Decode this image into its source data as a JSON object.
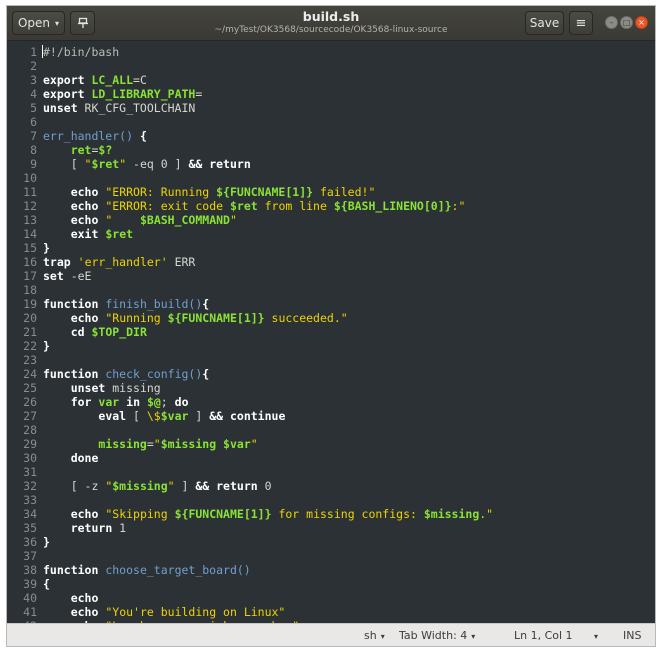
{
  "window": {
    "title": "build.sh",
    "subtitle": "~/myTest/OK3568/sourcecode/OK3568-linux-source"
  },
  "header": {
    "open_label": "Open",
    "open_caret": "▾",
    "pin_icon": "pin-icon",
    "save_label": "Save",
    "menu_glyph": "≡",
    "min_glyph": "–",
    "max_glyph": "□",
    "close_glyph": "×"
  },
  "colors": {
    "editor_bg": "#2b3135",
    "keyword": "#ffffff",
    "variable": "#8ae234",
    "string": "#edd400",
    "function_name": "#729fcf",
    "line_number": "#878c8f",
    "close_button": "#e8582a"
  },
  "editor": {
    "language": "sh",
    "lines": [
      [
        [
          "cm",
          "#!/bin/bash"
        ]
      ],
      [],
      [
        [
          "kw",
          "export"
        ],
        [
          "tx",
          " "
        ],
        [
          "var",
          "LC_ALL"
        ],
        [
          "tx",
          "=C"
        ]
      ],
      [
        [
          "kw",
          "export"
        ],
        [
          "tx",
          " "
        ],
        [
          "var",
          "LD_LIBRARY_PATH"
        ],
        [
          "tx",
          "="
        ]
      ],
      [
        [
          "kw",
          "unset"
        ],
        [
          "tx",
          " RK_CFG_TOOLCHAIN"
        ]
      ],
      [],
      [
        [
          "fn",
          "err_handler()"
        ],
        [
          "tx",
          " "
        ],
        [
          "kw",
          "{"
        ]
      ],
      [
        [
          "tx",
          "    "
        ],
        [
          "var",
          "ret"
        ],
        [
          "tx",
          "="
        ],
        [
          "var",
          "$?"
        ]
      ],
      [
        [
          "tx",
          "    [ "
        ],
        [
          "str",
          "\""
        ],
        [
          "var",
          "$ret"
        ],
        [
          "str",
          "\""
        ],
        [
          "tx",
          " -eq 0 ] "
        ],
        [
          "kw",
          "&& return"
        ]
      ],
      [],
      [
        [
          "tx",
          "    "
        ],
        [
          "kw",
          "echo"
        ],
        [
          "tx",
          " "
        ],
        [
          "str",
          "\"ERROR: Running "
        ],
        [
          "var",
          "${FUNCNAME[1]}"
        ],
        [
          "str",
          " failed!\""
        ]
      ],
      [
        [
          "tx",
          "    "
        ],
        [
          "kw",
          "echo"
        ],
        [
          "tx",
          " "
        ],
        [
          "str",
          "\"ERROR: exit code "
        ],
        [
          "var",
          "$ret"
        ],
        [
          "str",
          " from line "
        ],
        [
          "var",
          "${BASH_LINENO[0]}"
        ],
        [
          "str",
          ":\""
        ]
      ],
      [
        [
          "tx",
          "    "
        ],
        [
          "kw",
          "echo"
        ],
        [
          "tx",
          " "
        ],
        [
          "str",
          "\"    "
        ],
        [
          "var",
          "$BASH_COMMAND"
        ],
        [
          "str",
          "\""
        ]
      ],
      [
        [
          "tx",
          "    "
        ],
        [
          "kw",
          "exit"
        ],
        [
          "tx",
          " "
        ],
        [
          "var",
          "$ret"
        ]
      ],
      [
        [
          "kw",
          "}"
        ]
      ],
      [
        [
          "kw",
          "trap"
        ],
        [
          "tx",
          " "
        ],
        [
          "str",
          "'err_handler'"
        ],
        [
          "tx",
          " ERR"
        ]
      ],
      [
        [
          "kw",
          "set"
        ],
        [
          "tx",
          " -eE"
        ]
      ],
      [],
      [
        [
          "kw",
          "function"
        ],
        [
          "tx",
          " "
        ],
        [
          "fn",
          "finish_build()"
        ],
        [
          "kw",
          "{"
        ]
      ],
      [
        [
          "tx",
          "    "
        ],
        [
          "kw",
          "echo"
        ],
        [
          "tx",
          " "
        ],
        [
          "str",
          "\"Running "
        ],
        [
          "var",
          "${FUNCNAME[1]}"
        ],
        [
          "str",
          " succeeded.\""
        ]
      ],
      [
        [
          "tx",
          "    "
        ],
        [
          "kw",
          "cd"
        ],
        [
          "tx",
          " "
        ],
        [
          "var",
          "$TOP_DIR"
        ]
      ],
      [
        [
          "kw",
          "}"
        ]
      ],
      [],
      [
        [
          "kw",
          "function"
        ],
        [
          "tx",
          " "
        ],
        [
          "fn",
          "check_config()"
        ],
        [
          "kw",
          "{"
        ]
      ],
      [
        [
          "tx",
          "    "
        ],
        [
          "kw",
          "unset"
        ],
        [
          "tx",
          " missing"
        ]
      ],
      [
        [
          "tx",
          "    "
        ],
        [
          "kw",
          "for"
        ],
        [
          "tx",
          " "
        ],
        [
          "var",
          "var"
        ],
        [
          "tx",
          " "
        ],
        [
          "kw",
          "in"
        ],
        [
          "tx",
          " "
        ],
        [
          "var",
          "$@"
        ],
        [
          "tx",
          "; "
        ],
        [
          "kw",
          "do"
        ]
      ],
      [
        [
          "tx",
          "        "
        ],
        [
          "kw",
          "eval"
        ],
        [
          "tx",
          " [ "
        ],
        [
          "str",
          "\\$"
        ],
        [
          "var",
          "$var"
        ],
        [
          "tx",
          " ] "
        ],
        [
          "kw",
          "&& continue"
        ]
      ],
      [],
      [
        [
          "tx",
          "        "
        ],
        [
          "var",
          "missing"
        ],
        [
          "tx",
          "="
        ],
        [
          "str",
          "\""
        ],
        [
          "var",
          "$missing $var"
        ],
        [
          "str",
          "\""
        ]
      ],
      [
        [
          "tx",
          "    "
        ],
        [
          "kw",
          "done"
        ]
      ],
      [],
      [
        [
          "tx",
          "    [ -z "
        ],
        [
          "str",
          "\""
        ],
        [
          "var",
          "$missing"
        ],
        [
          "str",
          "\""
        ],
        [
          "tx",
          " ] "
        ],
        [
          "kw",
          "&& return"
        ],
        [
          "tx",
          " 0"
        ]
      ],
      [],
      [
        [
          "tx",
          "    "
        ],
        [
          "kw",
          "echo"
        ],
        [
          "tx",
          " "
        ],
        [
          "str",
          "\"Skipping "
        ],
        [
          "var",
          "${FUNCNAME[1]}"
        ],
        [
          "str",
          " for missing configs: "
        ],
        [
          "var",
          "$missing"
        ],
        [
          "str",
          ".\""
        ]
      ],
      [
        [
          "tx",
          "    "
        ],
        [
          "kw",
          "return"
        ],
        [
          "tx",
          " 1"
        ]
      ],
      [
        [
          "kw",
          "}"
        ]
      ],
      [],
      [
        [
          "kw",
          "function"
        ],
        [
          "tx",
          " "
        ],
        [
          "fn",
          "choose_target_board()"
        ]
      ],
      [
        [
          "kw",
          "{"
        ]
      ],
      [
        [
          "tx",
          "    "
        ],
        [
          "kw",
          "echo"
        ]
      ],
      [
        [
          "tx",
          "    "
        ],
        [
          "kw",
          "echo"
        ],
        [
          "tx",
          " "
        ],
        [
          "str",
          "\"You're building on Linux\""
        ]
      ],
      [
        [
          "tx",
          "    "
        ],
        [
          "kw",
          "echo"
        ],
        [
          "tx",
          " "
        ],
        [
          "str",
          "\"Lunch menu...pick a combo:\""
        ]
      ]
    ]
  },
  "statusbar": {
    "language": "sh",
    "tab_width": "Tab Width: 4",
    "position": "Ln 1, Col 1",
    "mode": "INS",
    "dropdown_glyph": "▾"
  }
}
